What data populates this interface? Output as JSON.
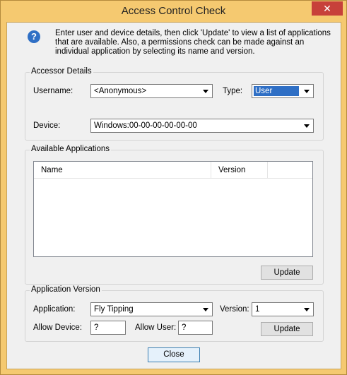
{
  "window": {
    "title": "Access Control Check",
    "close_glyph": "✕"
  },
  "info": {
    "icon": "question-icon",
    "icon_glyph": "?",
    "text": "Enter user and device details, then click 'Update' to view a list of applications that are available. Also, a permissions check can be made against an individual application by selecting its name and version."
  },
  "accessor": {
    "group_label": "Accessor Details",
    "username_label": "Username:",
    "username_value": "<Anonymous>",
    "type_label": "Type:",
    "type_value": "User",
    "device_label": "Device:",
    "device_value": "Windows:00-00-00-00-00-00"
  },
  "applications": {
    "group_label": "Available Applications",
    "columns": [
      "Name",
      "Version"
    ],
    "rows": [],
    "update_label": "Update"
  },
  "version": {
    "group_label": "Application Version",
    "application_label": "Application:",
    "application_value": "Fly Tipping",
    "version_label": "Version:",
    "version_value": "1",
    "allow_device_label": "Allow Device:",
    "allow_device_value": "?",
    "allow_user_label": "Allow User:",
    "allow_user_value": "?",
    "update_label": "Update"
  },
  "footer": {
    "close_label": "Close"
  }
}
